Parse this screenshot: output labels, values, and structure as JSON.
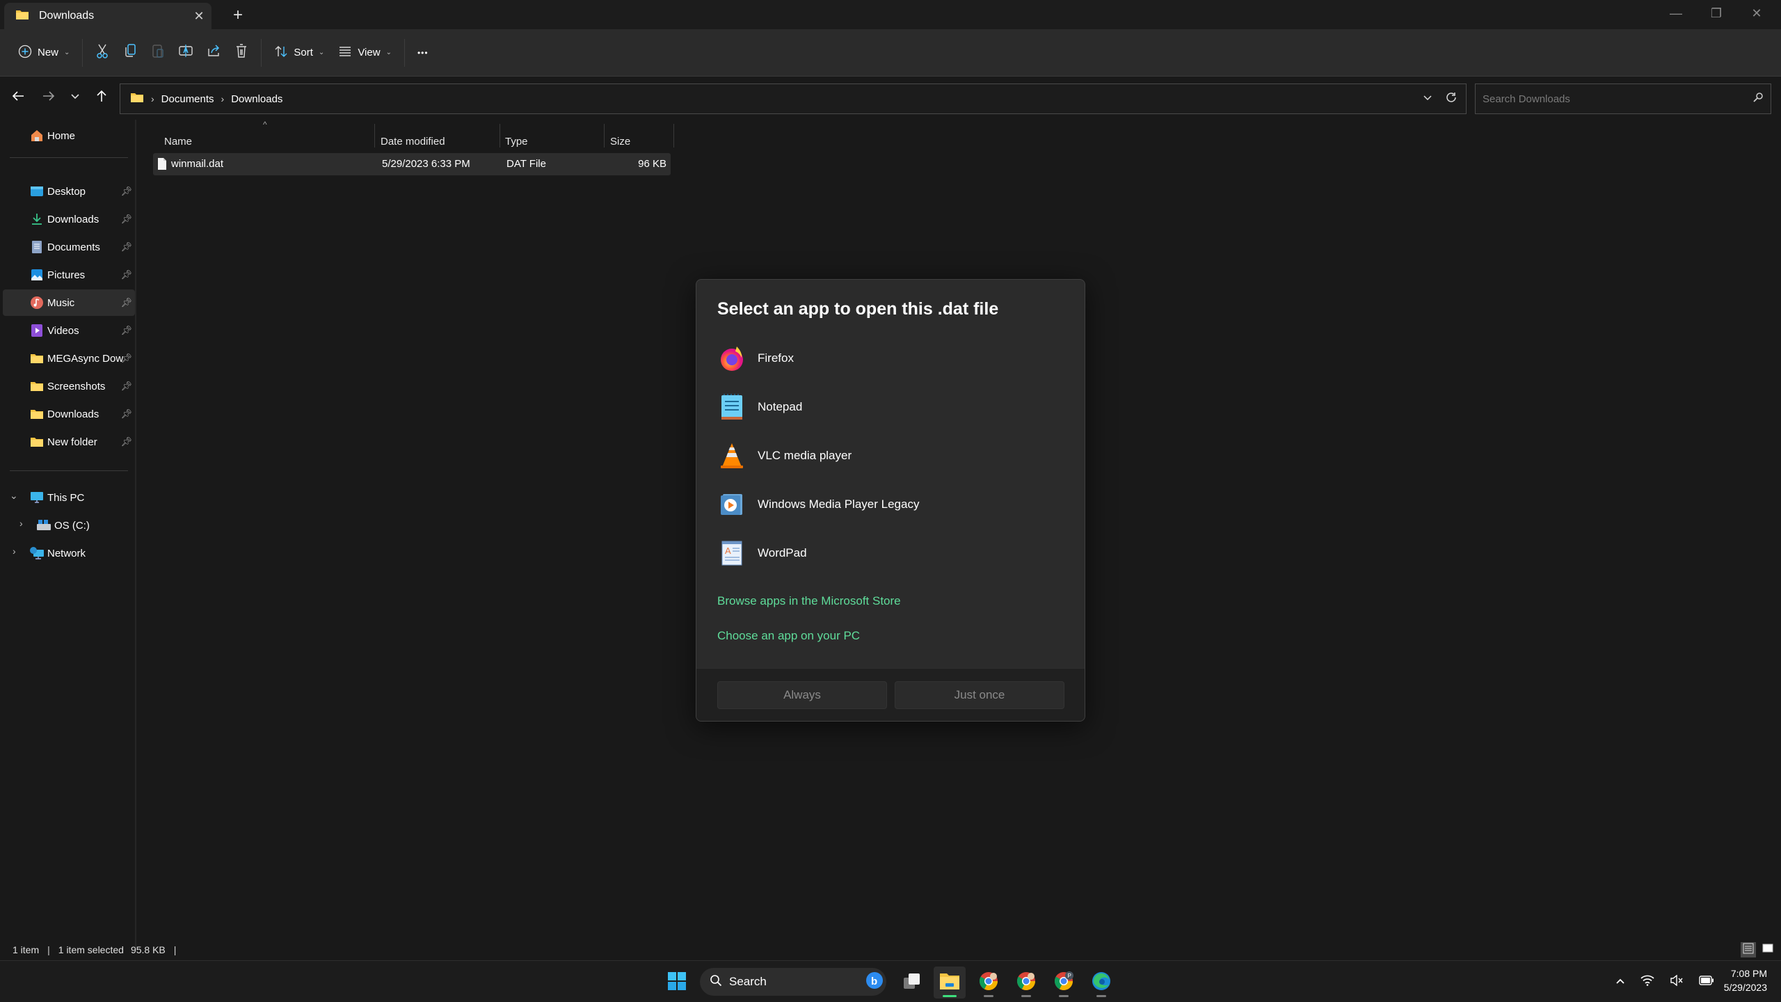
{
  "window": {
    "tab_title": "Downloads",
    "tab_icon": "folder-icon",
    "new_tab_symbol": "+",
    "close_tab_symbol": "✕",
    "controls": {
      "minimize": "—",
      "maximize": "❐",
      "close": "✕"
    }
  },
  "command_bar": {
    "new_label": "New",
    "sort_label": "Sort",
    "view_label": "View",
    "more_symbol": "•••",
    "icons": [
      "cut-icon",
      "copy-icon",
      "paste-icon",
      "rename-icon",
      "share-icon",
      "delete-icon"
    ]
  },
  "address": {
    "breadcrumbs": [
      "Documents",
      "Downloads"
    ],
    "search_placeholder": "Search Downloads"
  },
  "sidebar": {
    "home": "Home",
    "quick_access": [
      {
        "label": "Desktop",
        "icon": "desktop-icon",
        "pinned": true
      },
      {
        "label": "Downloads",
        "icon": "downloads-icon",
        "pinned": true
      },
      {
        "label": "Documents",
        "icon": "documents-icon",
        "pinned": true
      },
      {
        "label": "Pictures",
        "icon": "pictures-icon",
        "pinned": true
      },
      {
        "label": "Music",
        "icon": "music-icon",
        "pinned": true,
        "selected": true
      },
      {
        "label": "Videos",
        "icon": "videos-icon",
        "pinned": true
      },
      {
        "label": "MEGAsync Downl",
        "icon": "folder-icon",
        "pinned": true
      },
      {
        "label": "Screenshots",
        "icon": "folder-icon",
        "pinned": true
      },
      {
        "label": "Downloads",
        "icon": "folder-icon",
        "pinned": true
      },
      {
        "label": "New folder",
        "icon": "folder-icon",
        "pinned": true
      }
    ],
    "this_pc": "This PC",
    "os_drive": "OS (C:)",
    "network": "Network"
  },
  "file_list": {
    "columns": [
      "Name",
      "Date modified",
      "Type",
      "Size"
    ],
    "rows": [
      {
        "name": "winmail.dat",
        "date_modified": "5/29/2023 6:33 PM",
        "type": "DAT File",
        "size": "96 KB"
      }
    ]
  },
  "status_bar": {
    "item_count": "1 item",
    "selection": "1 item selected",
    "selection_size": "95.8 KB"
  },
  "dialog": {
    "title": "Select an app to open this .dat file",
    "apps": [
      {
        "label": "Firefox",
        "icon": "firefox-icon"
      },
      {
        "label": "Notepad",
        "icon": "notepad-icon"
      },
      {
        "label": "VLC media player",
        "icon": "vlc-icon"
      },
      {
        "label": "Windows Media Player Legacy",
        "icon": "wmp-icon"
      },
      {
        "label": "WordPad",
        "icon": "wordpad-icon"
      }
    ],
    "link_store": "Browse apps in the Microsoft Store",
    "link_pc": "Choose an app on your PC",
    "button_always": "Always",
    "button_once": "Just once",
    "link_color": "#5fdc9a"
  },
  "taskbar": {
    "search_label": "Search",
    "time": "7:08 PM",
    "date": "5/29/2023",
    "apps": [
      "start-icon",
      "task-view-icon",
      "file-explorer-icon",
      "chrome-icon",
      "chrome-icon",
      "chrome-icon",
      "edge-icon"
    ],
    "active_app": "file-explorer-icon",
    "active_indicator_color": "#3ee07e"
  }
}
